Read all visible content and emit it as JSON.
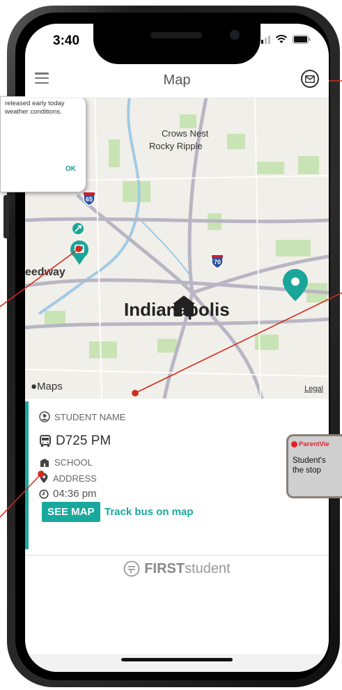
{
  "status_bar": {
    "time": "3:40"
  },
  "header": {
    "title": "Map",
    "menu_icon": "hamburger-menu-icon",
    "mail_icon": "envelope-icon"
  },
  "map": {
    "places": {
      "crows_nest": "Crows Nest",
      "rocky_ripple": "Rocky Ripple",
      "speedway": "eedway",
      "indianapolis": "Indianapolis"
    },
    "shields": {
      "i65": "65",
      "i70": "70"
    },
    "attribution": "Maps",
    "legal": "Legal",
    "marker_color": "#1aa59a"
  },
  "panel": {
    "student_label": "STUDENT NAME",
    "route": "D725 PM",
    "school_label": "SCHOOL",
    "address_label": "ADDRESS",
    "time": "04:36 pm",
    "see_map_button": "SEE MAP",
    "track_link": "Track bus on map",
    "accent_color": "#19a99c"
  },
  "brand": {
    "bold": "FIRST",
    "rest": "student"
  },
  "alert_callout": {
    "line1": "released early today",
    "line2": "weather conditions.",
    "ok": "OK"
  },
  "notification_callout": {
    "app_name": "ParentVie",
    "line1": "Student's",
    "line2": "the stop"
  }
}
